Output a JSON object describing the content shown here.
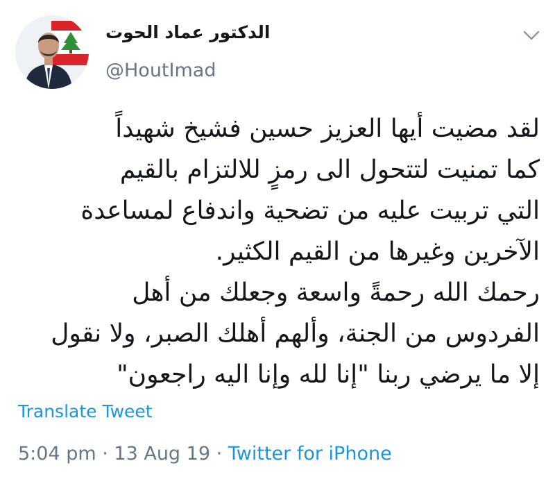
{
  "tweet": {
    "author": {
      "display_name": "الدكتور عماد الحوت",
      "handle": "@HoutImad"
    },
    "text_lines": [
      "لقد مضيت أيها العزيز حسين فشيخ شهيداً",
      "كما تمنيت لتتحول الى رمزٍ للالتزام بالقيم",
      "التي تربيت عليه من تضحية واندفاع لمساعدة",
      "الآخرين وغيرها من القيم الكثير.",
      "رحمك الله رحمةً واسعة وجعلك من أهل",
      "الفردوس من الجنة، وألهم أهلك الصبر، ولا نقول",
      "إلا ما يرضي ربنا \"إنا لله وإنا اليه راجعون\""
    ],
    "translate_label": "Translate Tweet",
    "time": "5:04 pm",
    "separator": " · ",
    "date": "13 Aug 19",
    "source": "Twitter for iPhone"
  },
  "colors": {
    "link": "#1b95e0",
    "muted": "#657786",
    "text": "#14171a"
  },
  "icons": {
    "menu": "chevron-down-icon",
    "avatar_flag": "lebanon-flag-cedar"
  }
}
